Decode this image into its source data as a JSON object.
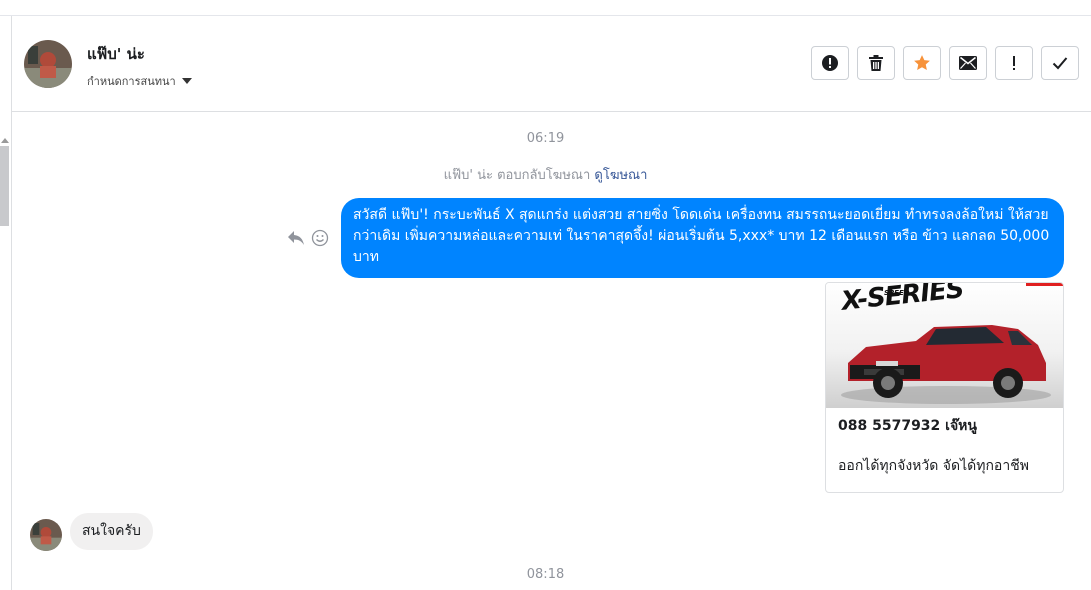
{
  "header": {
    "name": "แฟ๊บ' น่ะ",
    "subtitle": "กำหนดการสนทนา",
    "actions": [
      {
        "id": "report",
        "icon": "alert-circle-icon"
      },
      {
        "id": "delete",
        "icon": "trash-icon"
      },
      {
        "id": "star",
        "icon": "star-icon",
        "color": "#f7923a"
      },
      {
        "id": "mark-unread",
        "icon": "envelope-icon"
      },
      {
        "id": "important",
        "icon": "exclamation-icon"
      },
      {
        "id": "done",
        "icon": "check-icon"
      }
    ]
  },
  "conversation": {
    "time1": "06:19",
    "reply_notice": {
      "text": "แฟ๊บ' น่ะ ตอบกลับโฆษณา",
      "link": "ดูโฆษณา"
    },
    "outgoing_message": "สวัสดี แฟ๊บ'! กระบะพันธ์ X สุดแกร่ง แต่งสวย สายซิ่ง โดดเด่น เครื่องทน สมรรถนะยอดเยี่ยม ทำทรงลงล้อใหม่ ให้สวยกว่าเดิม เพิ่มความหล่อและความเท่ ในราคาสุดจึ้ง! ผ่อนเริ่มต้น 5,xxx* บาท 12 เดือนแรก หรือ ข้าว แลกลด 50,000 บาท",
    "ad_card": {
      "logo_small": "SPEED",
      "logo_big": "X-SERIES",
      "title": "088 5577932 เจ๊หนู",
      "description": "ออกได้ทุกจังหวัด จัดได้ทุกอาชีพ"
    },
    "incoming_message": "สนใจครับ",
    "time2": "08:18"
  },
  "colors": {
    "accent_blue": "#0084ff",
    "incoming_bubble": "#f1f0f0",
    "star_orange": "#f7923a"
  }
}
